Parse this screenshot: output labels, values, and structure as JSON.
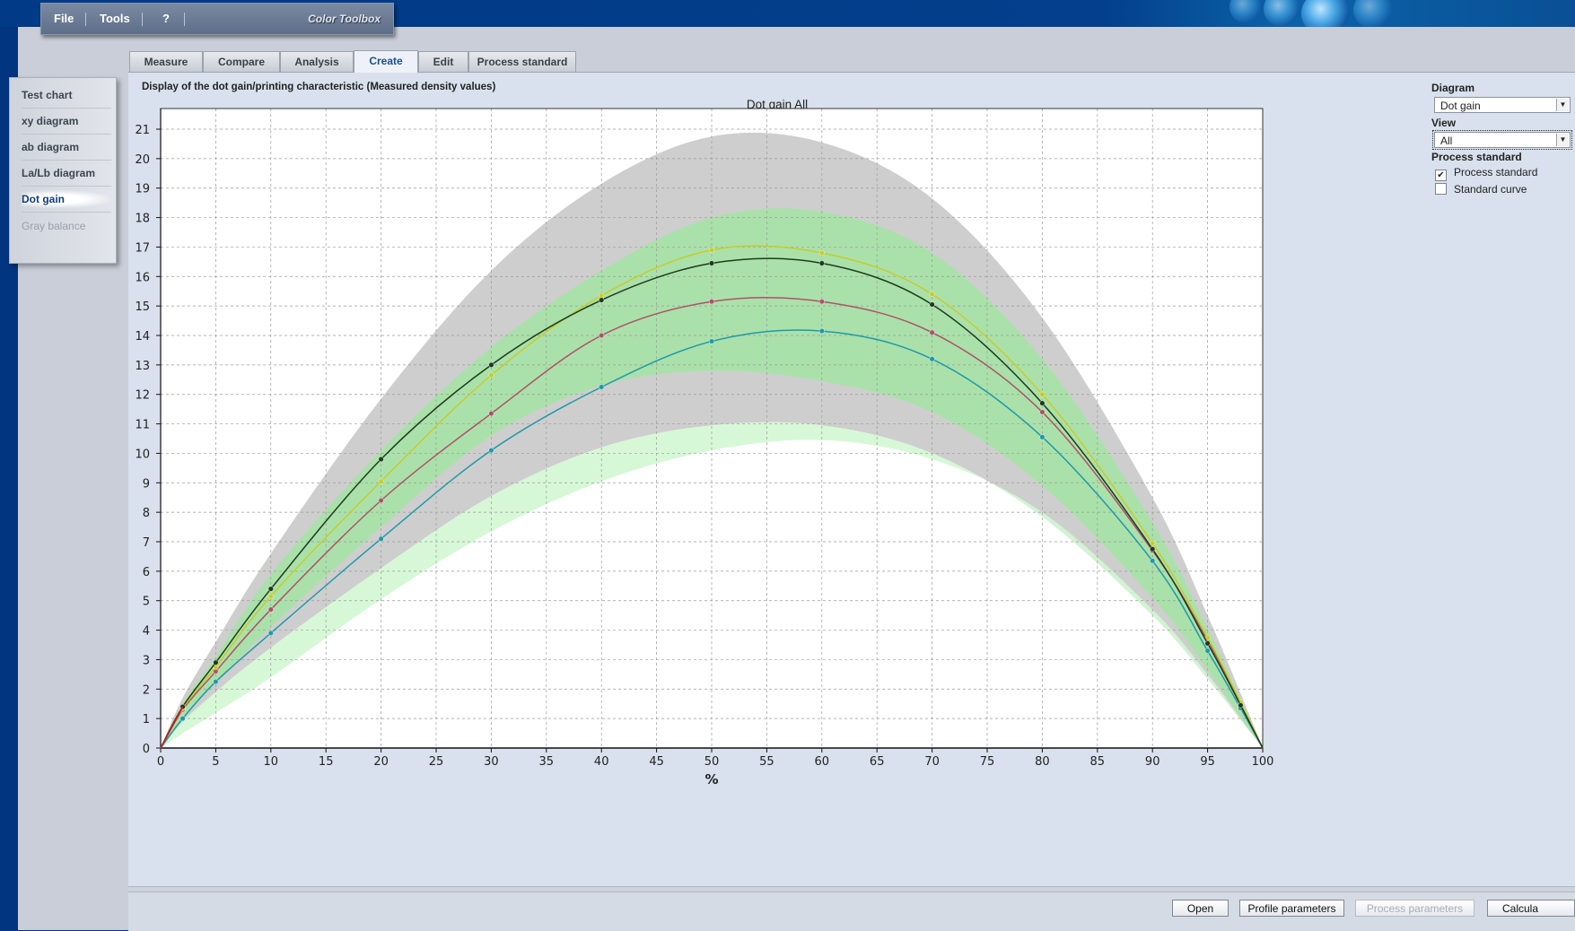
{
  "menu": {
    "items": [
      "File",
      "Tools",
      "?"
    ],
    "brand": "Color Toolbox"
  },
  "sidebar": {
    "items": [
      {
        "label": "Test chart",
        "state": "normal"
      },
      {
        "label": "xy diagram",
        "state": "normal"
      },
      {
        "label": "ab diagram",
        "state": "normal"
      },
      {
        "label": "La/Lb diagram",
        "state": "normal"
      },
      {
        "label": "Dot gain",
        "state": "active"
      },
      {
        "label": "Gray balance",
        "state": "disabled"
      }
    ]
  },
  "tabs": {
    "items": [
      "Measure",
      "Compare",
      "Analysis",
      "Create",
      "Edit",
      "Process standard"
    ],
    "active": "Create"
  },
  "panel": {
    "title": "Display of the dot gain/printing characteristic (Measured density values)"
  },
  "right": {
    "diagram_label": "Diagram",
    "diagram_value": "Dot gain",
    "view_label": "View",
    "view_value": "All",
    "process_standard_label": "Process standard",
    "checkboxes": [
      {
        "label": "Process standard",
        "checked": true
      },
      {
        "label": "Standard curve",
        "checked": false
      }
    ]
  },
  "buttons": [
    {
      "label": "Open",
      "enabled": true
    },
    {
      "label": "Profile parameters",
      "enabled": true
    },
    {
      "label": "Process parameters",
      "enabled": false
    },
    {
      "label": "Calcula",
      "enabled": true
    }
  ],
  "colors": {
    "cyan": "#1e9aa8",
    "magenta": "#b0506a",
    "yellow": "#c8cc28",
    "black": "#1e3a1e",
    "band_gray": "#c9c9c9",
    "band_green": "#a6e3a6",
    "band_lightgreen": "#d2f7d2"
  },
  "chart_data": {
    "type": "line",
    "title": "Dot gain All",
    "xlabel": "%",
    "ylabel": "",
    "xlim": [
      0,
      100
    ],
    "ylim": [
      0,
      21.7
    ],
    "xticks": [
      0,
      5,
      10,
      15,
      20,
      25,
      30,
      35,
      40,
      45,
      50,
      55,
      60,
      65,
      70,
      75,
      80,
      85,
      90,
      95,
      100
    ],
    "yticks": [
      0,
      1,
      2,
      3,
      4,
      5,
      6,
      7,
      8,
      9,
      10,
      11,
      12,
      13,
      14,
      15,
      16,
      17,
      18,
      19,
      20,
      21
    ],
    "grid": true,
    "x": [
      0,
      2,
      5,
      10,
      20,
      30,
      40,
      50,
      60,
      70,
      80,
      90,
      95,
      98,
      100
    ],
    "series": [
      {
        "color_key": "cyan",
        "values": [
          0,
          1.0,
          2.25,
          3.9,
          7.1,
          10.1,
          12.25,
          13.8,
          14.15,
          13.2,
          10.55,
          6.35,
          3.3,
          1.35,
          0
        ]
      },
      {
        "color_key": "magenta",
        "values": [
          0,
          1.3,
          2.6,
          4.7,
          8.4,
          11.35,
          14.0,
          15.15,
          15.15,
          14.1,
          11.4,
          6.7,
          3.65,
          1.5,
          0
        ]
      },
      {
        "color_key": "yellow",
        "values": [
          0,
          1.35,
          2.75,
          5.15,
          9.05,
          12.65,
          15.35,
          16.9,
          16.8,
          15.4,
          12.0,
          6.95,
          3.75,
          1.55,
          0
        ]
      },
      {
        "color_key": "black",
        "values": [
          0,
          1.4,
          2.9,
          5.4,
          9.8,
          13.0,
          15.2,
          16.45,
          16.45,
          15.05,
          11.7,
          6.75,
          3.55,
          1.45,
          0
        ]
      }
    ],
    "bands": [
      {
        "color_key": "band_gray",
        "lower": [
          0,
          0.85,
          1.9,
          3.4,
          6.1,
          8.55,
          10.2,
          10.95,
          10.95,
          10.0,
          7.85,
          4.5,
          2.35,
          0.95,
          0
        ],
        "upper": [
          0,
          1.7,
          3.6,
          6.6,
          11.85,
          16.2,
          19.15,
          20.75,
          20.55,
          18.65,
          14.6,
          8.5,
          4.5,
          1.85,
          0
        ]
      },
      {
        "color_key": "band_green",
        "lower": [
          0,
          1.0,
          2.2,
          4.1,
          7.5,
          10.6,
          12.3,
          12.8,
          12.45,
          11.4,
          8.9,
          5.1,
          2.65,
          1.05,
          0
        ],
        "upper": [
          0,
          1.5,
          3.1,
          5.9,
          10.1,
          13.6,
          16.2,
          18.0,
          18.2,
          16.8,
          13.2,
          7.65,
          4.05,
          1.65,
          0
        ]
      },
      {
        "color_key": "band_lightgreen",
        "lower": [
          0,
          0.5,
          1.2,
          2.4,
          5.05,
          7.35,
          9.05,
          10.1,
          10.45,
          9.8,
          8.0,
          4.7,
          2.5,
          1.0,
          0
        ],
        "upper": [
          0,
          0.9,
          1.9,
          3.4,
          6.1,
          8.55,
          10.2,
          10.95,
          10.95,
          10.0,
          7.85,
          4.5,
          2.35,
          0.95,
          0
        ]
      }
    ]
  }
}
